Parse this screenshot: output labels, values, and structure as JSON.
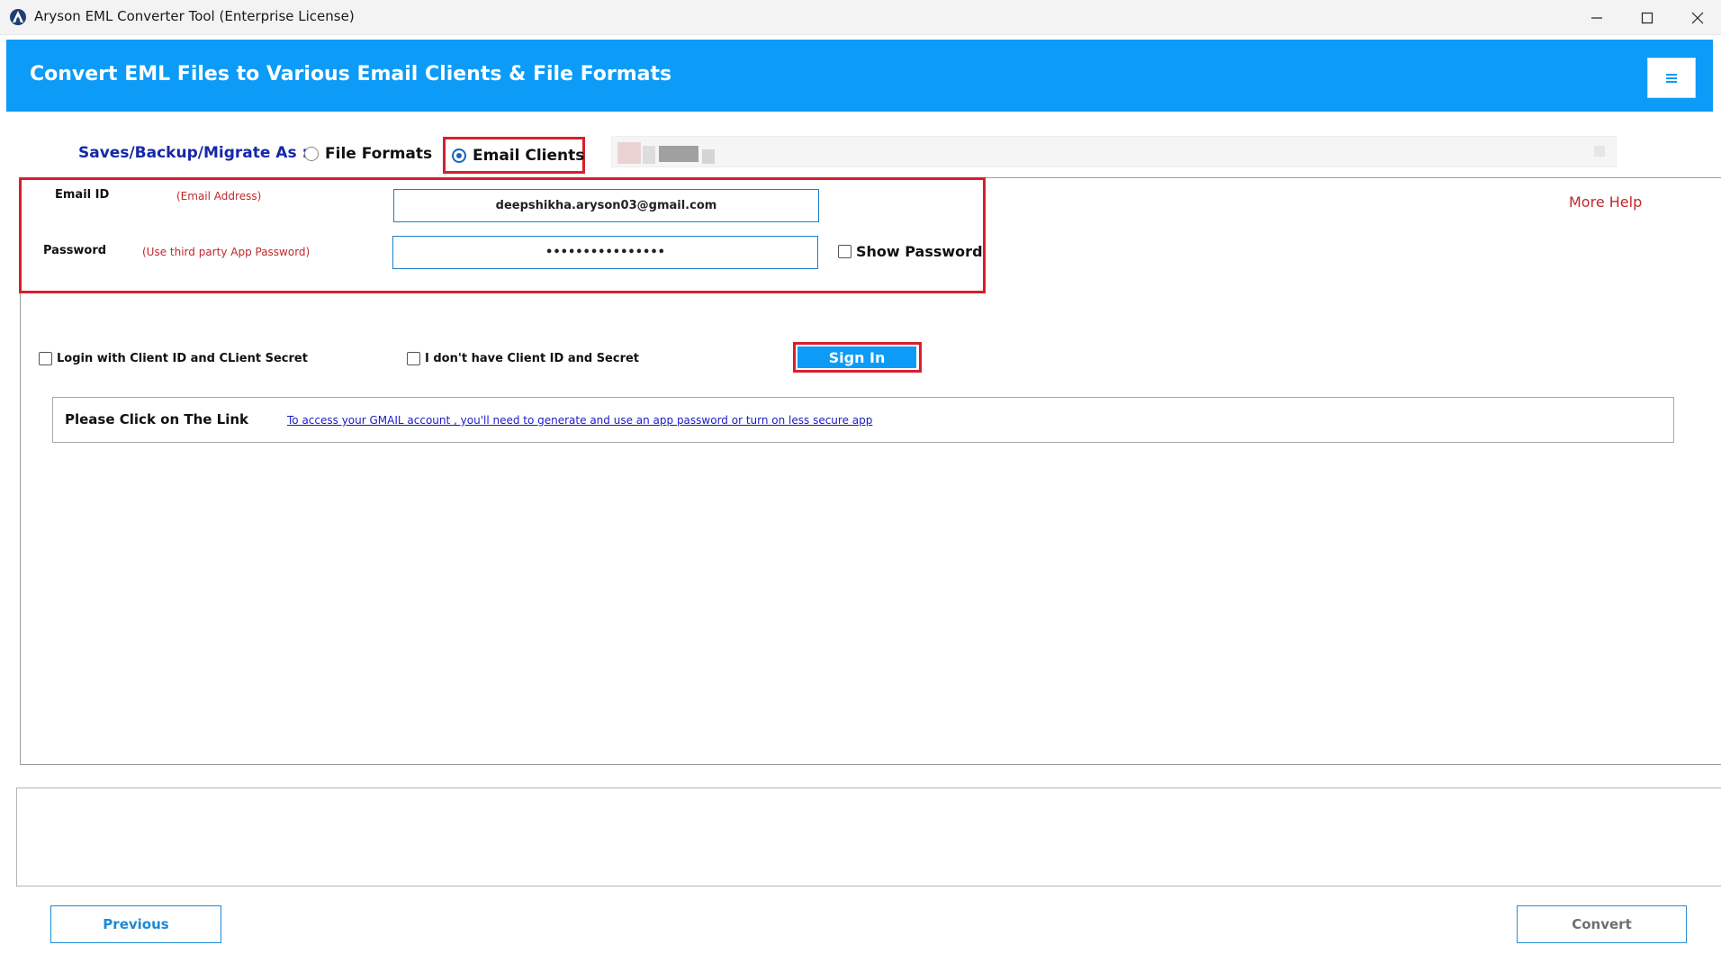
{
  "window": {
    "title": "Aryson EML Converter Tool (Enterprise License)",
    "controls": [
      "minimize-icon",
      "maximize-icon",
      "close-icon"
    ]
  },
  "header": {
    "title": "Convert EML Files to Various Email Clients & File Formats",
    "menu_icon": "hamburger-menu-icon",
    "accent_color": "#0c9bf7"
  },
  "options": {
    "label": "Saves/Backup/Migrate As :",
    "radio_file_formats": "File Formats",
    "radio_email_clients": "Email Clients",
    "selected": "Email Clients"
  },
  "form": {
    "email_label": "Email ID",
    "email_hint": "(Email Address)",
    "email_value": "deepshikha.aryson03@gmail.com",
    "password_label": "Password",
    "password_hint": "(Use third party App Password)",
    "password_value": "••••••••••••••••",
    "show_password_label": "Show Password",
    "more_help": "More Help",
    "login_client_id_label": "Login with Client ID and CLient Secret",
    "no_client_id_label": "I don't have Client ID and Secret",
    "sign_in_label": "Sign In"
  },
  "link_panel": {
    "label": "Please  Click on The Link",
    "link_text": "To access your GMAIL account , you'll need to generate and use an app password or turn on less secure app"
  },
  "footer": {
    "previous_label": "Previous",
    "convert_label": "Convert"
  },
  "highlight_color": "#d6202b"
}
